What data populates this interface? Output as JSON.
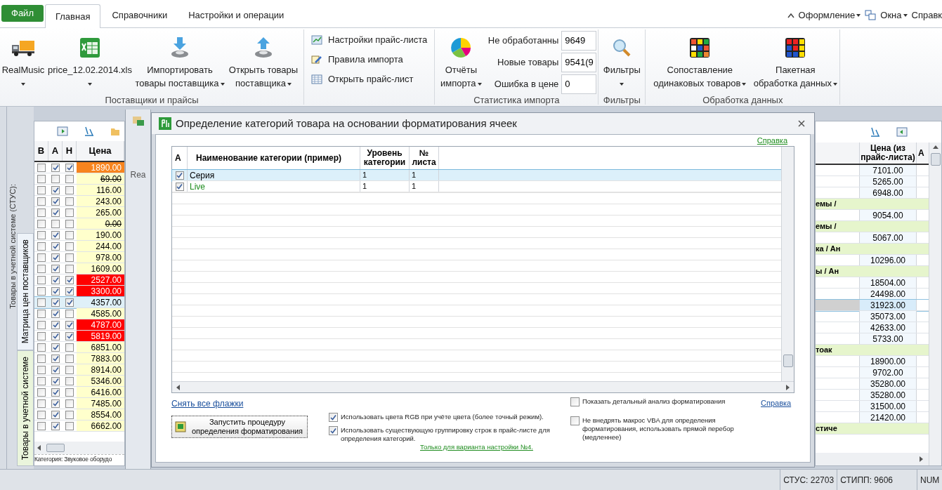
{
  "menu_tabs": [
    {
      "label": "Файл",
      "kind": "file",
      "selected": false
    },
    {
      "label": "Главная",
      "kind": "tab",
      "selected": true
    },
    {
      "label": "Справочники",
      "kind": "tab",
      "selected": false
    },
    {
      "label": "Настройки и операции",
      "kind": "tab",
      "selected": false
    }
  ],
  "menu_right": [
    {
      "label": "Оформление",
      "dropdown": true
    },
    {
      "label": "Окна",
      "dropdown": true
    },
    {
      "label": "Справк",
      "dropdown": false
    }
  ],
  "ribbon": {
    "groups": [
      {
        "kind": "large",
        "label": "Поставщики и прайсы",
        "buttons": [
          {
            "lines": [
              "RealMusic"
            ],
            "dropdown": true
          },
          {
            "lines": [
              "price_12.02.2014.xls"
            ],
            "dropdown": true
          },
          {
            "lines": [
              "Импортировать",
              "товары поставщика"
            ],
            "dropdown": true
          },
          {
            "lines": [
              "Открыть товары",
              "поставщика"
            ],
            "dropdown": true
          }
        ]
      },
      {
        "kind": "small",
        "buttons": [
          {
            "lines": [
              "Настройки прайс-листа"
            ]
          },
          {
            "lines": [
              "Правила импорта"
            ]
          },
          {
            "lines": [
              "Открыть прайс-лист"
            ]
          }
        ]
      },
      {
        "kind": "stats",
        "label": "Статистика импорта",
        "buttons": [
          {
            "lines": [
              "Отчёты",
              "импорта"
            ],
            "dropdown": true
          }
        ],
        "fields": [
          {
            "label": "Не обработанны",
            "value": "9649"
          },
          {
            "label": "Новые товары",
            "value": "9541(9"
          },
          {
            "label": "Ошибка в цене",
            "value": "0"
          }
        ]
      },
      {
        "kind": "large",
        "label": "Фильтры",
        "buttons": [
          {
            "lines": [
              "Фильтры"
            ],
            "dropdown": true
          }
        ]
      },
      {
        "kind": "large",
        "label": "Обработка данных",
        "buttons": [
          {
            "lines": [
              "Сопоставление",
              "одинаковых товаров"
            ],
            "dropdown": true
          },
          {
            "lines": [
              "Пакетная",
              "обработка данных"
            ],
            "dropdown": true
          }
        ]
      }
    ]
  },
  "left_panel": {
    "caption": "Товары в учетной системе (СТУС):",
    "tabs": [
      {
        "label": "Матрица цен поставщиков",
        "selected": true
      },
      {
        "label": "Товары в учетной системе",
        "selected": false
      }
    ],
    "columns": [
      "В",
      "А",
      "Н",
      "Цена"
    ],
    "rows": [
      {
        "v": false,
        "a": true,
        "n": true,
        "price": "1890.00",
        "kind": "warning",
        "struck": false,
        "selected": false
      },
      {
        "v": false,
        "a": false,
        "n": false,
        "price": "69.00",
        "kind": "normal",
        "struck": true,
        "selected": false
      },
      {
        "v": false,
        "a": true,
        "n": false,
        "price": "116.00",
        "kind": "normal",
        "struck": false,
        "selected": false
      },
      {
        "v": false,
        "a": true,
        "n": false,
        "price": "243.00",
        "kind": "normal",
        "struck": false,
        "selected": false
      },
      {
        "v": false,
        "a": true,
        "n": false,
        "price": "265.00",
        "kind": "normal",
        "struck": false,
        "selected": false
      },
      {
        "v": false,
        "a": false,
        "n": false,
        "price": "0.00",
        "kind": "normal",
        "struck": true,
        "selected": false
      },
      {
        "v": false,
        "a": true,
        "n": false,
        "price": "190.00",
        "kind": "normal",
        "struck": false,
        "selected": false
      },
      {
        "v": false,
        "a": true,
        "n": false,
        "price": "244.00",
        "kind": "normal",
        "struck": false,
        "selected": false
      },
      {
        "v": false,
        "a": true,
        "n": false,
        "price": "978.00",
        "kind": "normal",
        "struck": false,
        "selected": false
      },
      {
        "v": false,
        "a": true,
        "n": false,
        "price": "1609.00",
        "kind": "normal",
        "struck": false,
        "selected": false
      },
      {
        "v": false,
        "a": true,
        "n": true,
        "price": "2527.00",
        "kind": "error",
        "struck": false,
        "selected": false
      },
      {
        "v": false,
        "a": true,
        "n": true,
        "price": "3300.00",
        "kind": "error",
        "struck": false,
        "selected": false
      },
      {
        "v": false,
        "a": true,
        "n": true,
        "price": "4357.00",
        "kind": "normal",
        "struck": false,
        "selected": true
      },
      {
        "v": false,
        "a": true,
        "n": false,
        "price": "4585.00",
        "kind": "normal",
        "struck": false,
        "selected": false
      },
      {
        "v": false,
        "a": true,
        "n": true,
        "price": "4787.00",
        "kind": "error",
        "struck": false,
        "selected": false
      },
      {
        "v": false,
        "a": true,
        "n": true,
        "price": "5819.00",
        "kind": "error",
        "struck": false,
        "selected": false
      },
      {
        "v": false,
        "a": true,
        "n": false,
        "price": "6851.00",
        "kind": "normal",
        "struck": false,
        "selected": false
      },
      {
        "v": false,
        "a": true,
        "n": false,
        "price": "7883.00",
        "kind": "normal",
        "struck": false,
        "selected": false
      },
      {
        "v": false,
        "a": true,
        "n": false,
        "price": "8914.00",
        "kind": "normal",
        "struck": false,
        "selected": false
      },
      {
        "v": false,
        "a": true,
        "n": false,
        "price": "5346.00",
        "kind": "normal",
        "struck": false,
        "selected": false
      },
      {
        "v": false,
        "a": true,
        "n": false,
        "price": "6416.00",
        "kind": "normal",
        "struck": false,
        "selected": false
      },
      {
        "v": false,
        "a": true,
        "n": false,
        "price": "7485.00",
        "kind": "normal",
        "struck": false,
        "selected": false
      },
      {
        "v": false,
        "a": true,
        "n": false,
        "price": "8554.00",
        "kind": "normal",
        "struck": false,
        "selected": false
      },
      {
        "v": false,
        "a": true,
        "n": false,
        "price": "6662.00",
        "kind": "normal",
        "struck": false,
        "selected": false
      }
    ],
    "footer": "Категория: Звуковое оборудо"
  },
  "background_window": {
    "text": "Rea"
  },
  "dialog": {
    "title": "Определение категорий товара на основании форматирования ячеек",
    "help_link": "Справка",
    "columns": [
      "А",
      "Наименование категории (пример)",
      "Уровень категории",
      "№ листа"
    ],
    "rows": [
      {
        "checked": true,
        "name": "Серия",
        "category_level": "1",
        "sheet": "1",
        "color": "#000000",
        "selected": true
      },
      {
        "checked": true,
        "name": "Live",
        "category_level": "1",
        "sheet": "1",
        "color": "#1e8c1e",
        "selected": false
      }
    ],
    "uncheck_all_link": "Снять все флажки",
    "run_button": "Запустить процедуру определения форматирования",
    "options": [
      {
        "label": "Использовать цвета RGB при учёте цвета (более точный режим).",
        "checked": true
      },
      {
        "label": "Использовать существующую группировку строк в прайс-листе для определения категорий.",
        "link": "Только для варианта настройки №4.",
        "checked": true
      }
    ],
    "right_options": [
      {
        "label": "Показать детальный анализ форматирования",
        "checked": false
      },
      {
        "label": "Не внедрять макрос VBA для определения форматирования, использовать прямой перебор (медленнее)",
        "checked": false
      }
    ],
    "bottom_help_link": "Справка"
  },
  "right_panel": {
    "columns": [
      "Цена (из прайс-листа)",
      "А"
    ],
    "rows": [
      {
        "kind": "item",
        "price": "7101.00",
        "selected": false
      },
      {
        "kind": "item",
        "price": "5265.00",
        "selected": false
      },
      {
        "kind": "item",
        "price": "6948.00",
        "selected": false
      },
      {
        "kind": "group",
        "name": "емы /",
        "selected": false
      },
      {
        "kind": "item",
        "price": "9054.00",
        "selected": false
      },
      {
        "kind": "group",
        "name": "емы /",
        "selected": false
      },
      {
        "kind": "item",
        "price": "5067.00",
        "selected": false
      },
      {
        "kind": "group",
        "name": "ка / Ан",
        "selected": false
      },
      {
        "kind": "item",
        "price": "10296.00",
        "selected": false
      },
      {
        "kind": "group",
        "name": "ы / Ан",
        "selected": false
      },
      {
        "kind": "item",
        "price": "18504.00",
        "selected": false
      },
      {
        "kind": "item",
        "price": "24498.00",
        "selected": false
      },
      {
        "kind": "item",
        "price": "31923.00",
        "selected": true
      },
      {
        "kind": "item",
        "price": "35073.00",
        "selected": false
      },
      {
        "kind": "item",
        "price": "42633.00",
        "selected": false
      },
      {
        "kind": "item",
        "price": "5733.00",
        "selected": false
      },
      {
        "kind": "group",
        "name": "тоак",
        "selected": false
      },
      {
        "kind": "item",
        "price": "18900.00",
        "selected": false
      },
      {
        "kind": "item",
        "price": "9702.00",
        "selected": false
      },
      {
        "kind": "item",
        "price": "35280.00",
        "selected": false
      },
      {
        "kind": "item",
        "price": "35280.00",
        "selected": false
      },
      {
        "kind": "item",
        "price": "31500.00",
        "selected": false
      },
      {
        "kind": "item",
        "price": "21420.00",
        "selected": false
      },
      {
        "kind": "group",
        "name": "стиче",
        "selected": false
      }
    ]
  },
  "status_bar": [
    "СТУС: 22703",
    "СТИПП: 9606",
    "NUM"
  ]
}
